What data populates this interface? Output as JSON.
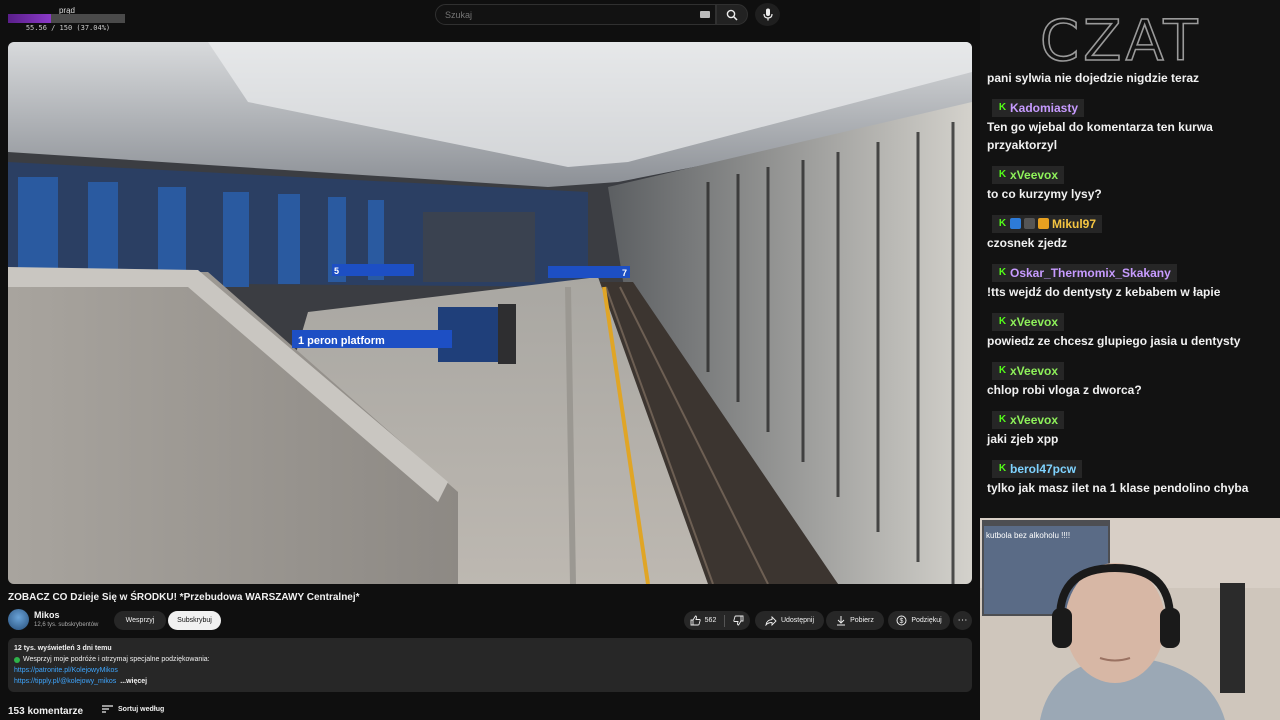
{
  "hud": {
    "title": "prąd",
    "value_text": "55.56 / 150 (37.04%)",
    "progress": 0.3704
  },
  "search": {
    "placeholder": "Szukaj"
  },
  "video": {
    "signs": {
      "platform_sign": "1 peron platform",
      "sign_left": "5",
      "sign_right": "7"
    },
    "title": "ZOBACZ CO Dzieje Się w ŚRODKU! *Przebudowa WARSZAWY Centralnej*"
  },
  "channel": {
    "name": "Mikos",
    "subscribers": "12,6 tys. subskrybentów",
    "support_label": "Wesprzyj",
    "subscribe_label": "Subskrybuj"
  },
  "actions": {
    "likes": "562",
    "share_label": "Udostępnij",
    "download_label": "Pobierz",
    "thanks_label": "Podziękuj",
    "more_label": "⋯"
  },
  "description": {
    "meta": "12 tys. wyświetleń  3 dni temu",
    "line1": "Wesprzyj moje podróże i otrzymaj specjalne podziękowania:",
    "link1": "https://patronite.pl/KolejowyMikos",
    "link2": "https://tipply.pl/@kolejowy_mikos",
    "more_label": "...więcej"
  },
  "comments": {
    "count_label": "153 komentarze",
    "sort_label": "Sortuj według"
  },
  "chat": {
    "logo_text": "CZAT",
    "messages": [
      {
        "user": "",
        "text": "pani sylwia nie dojedzie nigdzie teraz",
        "color": "#ffffff"
      },
      {
        "user": "Kadomiasty",
        "text": "Ten go wjebal do komentarza ten kurwa przyaktorzyl",
        "color": "#c79bff"
      },
      {
        "user": "xVeevox",
        "text": "to co kurzymy lysy?",
        "color": "#8ef05a"
      },
      {
        "user": "Mikul97",
        "text": "czosnek zjedz",
        "color": "#f5c542"
      },
      {
        "user": "Oskar_Thermomix_Skakany",
        "text": "!tts wejdź do dentysty z kebabem w łapie",
        "color": "#c79bff"
      },
      {
        "user": "xVeevox",
        "text": "powiedz ze chcesz glupiego jasia u dentysty",
        "color": "#8ef05a"
      },
      {
        "user": "xVeevox",
        "text": "chlop robi vloga z dworca?",
        "color": "#8ef05a"
      },
      {
        "user": "xVeevox",
        "text": "jaki zjeb xpp",
        "color": "#8ef05a"
      },
      {
        "user": "berol47pcw",
        "text": "tylko jak masz ilet na 1 klase pendolino chyba",
        "color": "#7fd3ff"
      }
    ]
  },
  "webcam": {
    "poster_text": "kutbola bez alkoholu !!!!"
  },
  "colors": {
    "accent_kick": "#53fc18",
    "link": "#3ea6ff",
    "hud_fill": "#7a32b8"
  }
}
